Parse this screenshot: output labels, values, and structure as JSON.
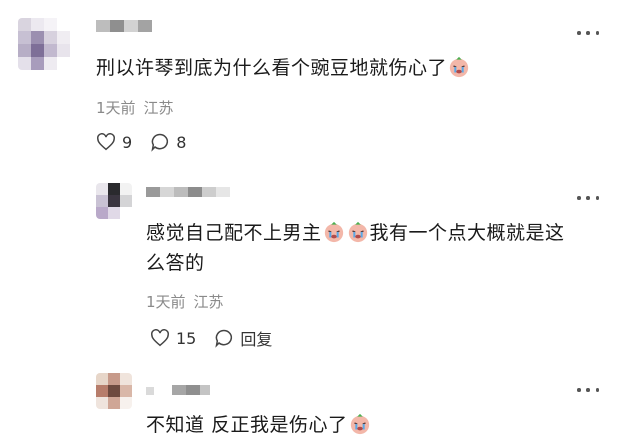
{
  "comments": [
    {
      "text": "刑以许琴到底为什么看个豌豆地就伤心了",
      "time": "1天前",
      "location": "江苏",
      "like_count": "9",
      "reply_label": "8"
    },
    {
      "text_part1": "感觉自己配不上男主",
      "text_part2": "我有一个点大概就是这",
      "text_part3": "么答的",
      "time": "1天前",
      "location": "江苏",
      "like_count": "15",
      "reply_label": "回复"
    },
    {
      "text": "不知道 反正我是伤心了"
    }
  ],
  "icons": {
    "more": "more-dots-icon",
    "like": "heart-icon",
    "reply": "speech-bubble-icon",
    "emoji": "crying-face-emoji"
  },
  "colors": {
    "meta": "#8a8a8a",
    "emoji_face": "#f3b7a9",
    "emoji_tears": "#5aa8e6"
  }
}
